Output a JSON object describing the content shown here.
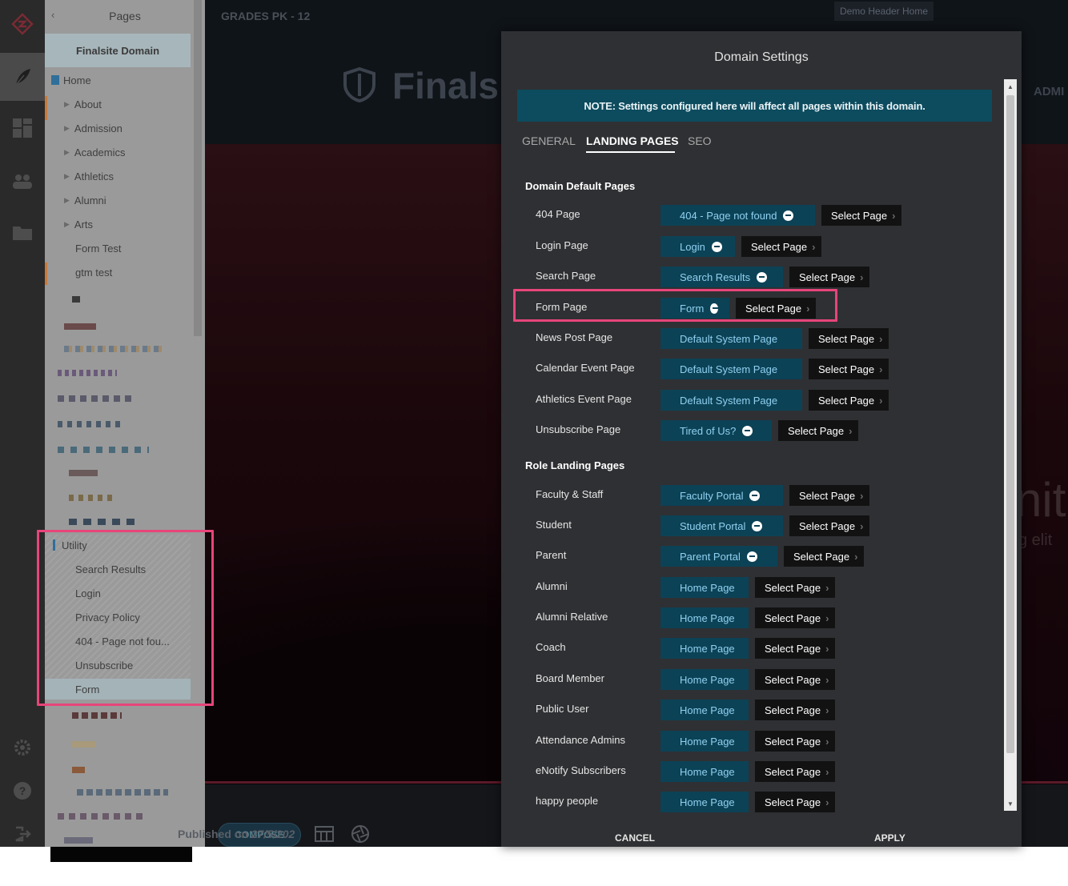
{
  "pages_panel": {
    "title": "Pages",
    "back": "‹",
    "domain": "Finalsite Domain",
    "tree": [
      {
        "label": "Home"
      },
      {
        "label": "About"
      },
      {
        "label": "Admission"
      },
      {
        "label": "Academics"
      },
      {
        "label": "Athletics"
      },
      {
        "label": "Alumni"
      },
      {
        "label": "Arts"
      },
      {
        "label": "Form Test"
      },
      {
        "label": "gtm test"
      }
    ],
    "utility": {
      "label": "Utility",
      "children": [
        "Search Results",
        "Login",
        "Privacy Policy",
        "404 - Page not fou...",
        "Unsubscribe",
        "Form"
      ]
    }
  },
  "site": {
    "grades": "GRADES PK - 12",
    "demo_header_home": "Demo Header Home",
    "logo_text": "Finalsit",
    "nav_partial": "ADMI",
    "hero_partial": "nit",
    "hero_sub_partial": "g elit",
    "compose": "COMPOSE",
    "published_prefix": "Published on ",
    "published_date": "27/5/202"
  },
  "modal": {
    "title": "Domain Settings",
    "note": "NOTE: Settings configured here will affect all pages within this domain.",
    "tabs": [
      "GENERAL",
      "LANDING PAGES",
      "SEO"
    ],
    "active_tab": "LANDING PAGES",
    "select_label": "Select Page",
    "domain_default": {
      "title": "Domain Default Pages",
      "rows": [
        {
          "label": "404 Page",
          "value": "404 - Page not found",
          "removable": true
        },
        {
          "label": "Login Page",
          "value": "Login",
          "removable": true
        },
        {
          "label": "Search Page",
          "value": "Search Results",
          "removable": true
        },
        {
          "label": "Form Page",
          "value": "Form",
          "removable": true
        },
        {
          "label": "News Post Page",
          "value": "Default System Page",
          "removable": false
        },
        {
          "label": "Calendar Event Page",
          "value": "Default System Page",
          "removable": false
        },
        {
          "label": "Athletics Event Page",
          "value": "Default System Page",
          "removable": false
        },
        {
          "label": "Unsubscribe Page",
          "value": "Tired of Us?",
          "removable": true
        }
      ]
    },
    "role_landing": {
      "title": "Role Landing Pages",
      "rows": [
        {
          "label": "Faculty & Staff",
          "value": "Faculty Portal",
          "removable": true
        },
        {
          "label": "Student",
          "value": "Student Portal",
          "removable": true
        },
        {
          "label": "Parent",
          "value": "Parent Portal",
          "removable": true
        },
        {
          "label": "Alumni",
          "value": "Home Page",
          "removable": false
        },
        {
          "label": "Alumni Relative",
          "value": "Home Page",
          "removable": false
        },
        {
          "label": "Coach",
          "value": "Home Page",
          "removable": false
        },
        {
          "label": "Board Member",
          "value": "Home Page",
          "removable": false
        },
        {
          "label": "Public User",
          "value": "Home Page",
          "removable": false
        },
        {
          "label": "Attendance Admins",
          "value": "Home Page",
          "removable": false
        },
        {
          "label": "eNotify Subscribers",
          "value": "Home Page",
          "removable": false
        },
        {
          "label": "happy people",
          "value": "Home Page",
          "removable": false
        }
      ]
    },
    "cancel": "CANCEL",
    "apply": "APPLY"
  },
  "colors": {
    "highlight": "#e7457a",
    "chip_bg": "#0c4256",
    "chip_text": "#8fd0f0",
    "note_bg": "#0d4b5e",
    "modal_bg": "#2f3033"
  }
}
